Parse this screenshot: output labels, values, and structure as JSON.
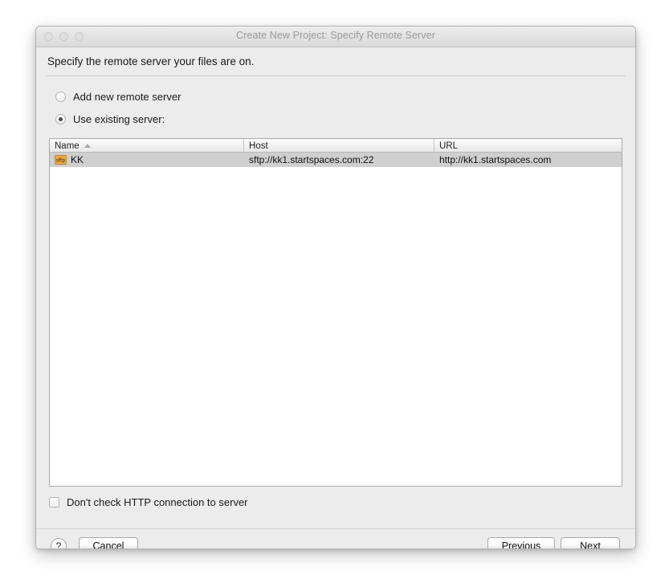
{
  "window": {
    "title": "Create New Project: Specify Remote Server",
    "traffic_lights": [
      "close-button",
      "minimize-button",
      "zoom-button"
    ]
  },
  "header": {
    "prompt": "Specify the remote server your files are on."
  },
  "options": {
    "add_new": {
      "label": "Add new remote server",
      "selected": false
    },
    "use_existing": {
      "label": "Use existing server:",
      "selected": true
    }
  },
  "table": {
    "sort_column": "Name",
    "sort_direction": "ascending",
    "columns": [
      {
        "label": "Name"
      },
      {
        "label": "Host"
      },
      {
        "label": "URL"
      }
    ],
    "rows": [
      {
        "icon": "sftp-icon",
        "name": "KK",
        "host": "sftp://kk1.startspaces.com:22",
        "url": "http://kk1.startspaces.com",
        "selected": true
      }
    ]
  },
  "checkbox": {
    "label": "Don't check HTTP connection to server",
    "checked": false
  },
  "footer": {
    "help_label": "?",
    "cancel_label": "Cancel",
    "previous_label": "Previous",
    "next_label": "Next"
  },
  "colors": {
    "dialog_bg": "#ececec",
    "title_text": "#9a9a9a",
    "selected_row": "#cfcfcf",
    "sftp_icon": "#e8a33d"
  }
}
